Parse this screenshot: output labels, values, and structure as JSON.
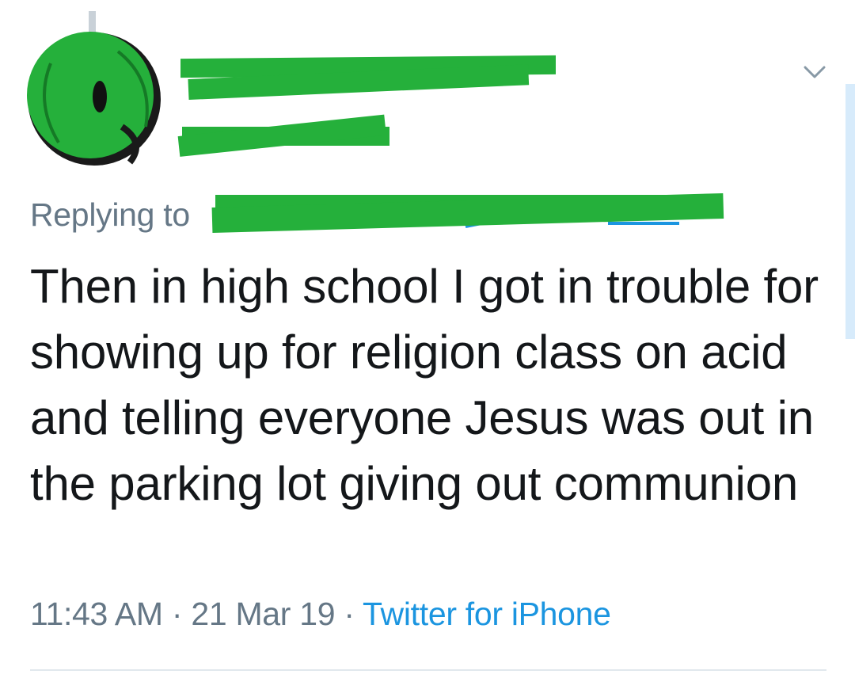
{
  "tweet": {
    "replying_label": "Replying to",
    "text": "Then in high school I got in trouble for showing up for religion class on acid and telling everyone Jesus was out in the parking lot giving out communion",
    "time": "11:43 AM",
    "separator": " · ",
    "date": "21 Mar 19",
    "source": "Twitter for iPhone"
  },
  "icons": {
    "menu": "chevron-down-icon",
    "avatar": "avatar-icon"
  },
  "colors": {
    "redaction": "#25b03b",
    "text": "#14171a",
    "secondary": "#657786",
    "link": "#1b95e0"
  }
}
